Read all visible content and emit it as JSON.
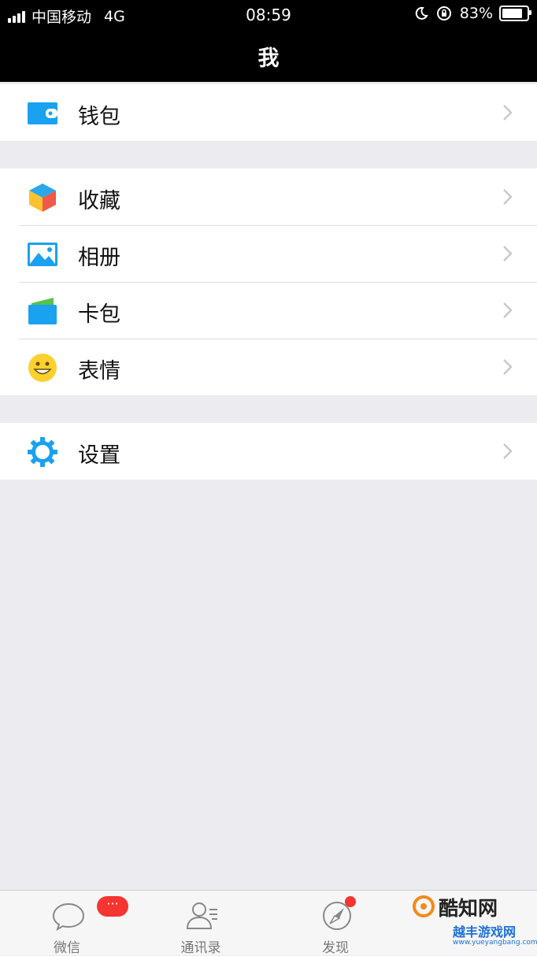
{
  "status_bar": {
    "carrier": "中国移动",
    "network": "4G",
    "time": "08:59",
    "battery": "83%",
    "battery_level": 0.83
  },
  "nav": {
    "title": "我"
  },
  "groups": [
    {
      "items": [
        {
          "label": "钱包",
          "icon": "wallet-icon"
        }
      ]
    },
    {
      "items": [
        {
          "label": "收藏",
          "icon": "favorites-cube-icon"
        },
        {
          "label": "相册",
          "icon": "album-picture-icon"
        },
        {
          "label": "卡包",
          "icon": "card-pack-icon"
        },
        {
          "label": "表情",
          "icon": "smiley-face-icon"
        }
      ]
    },
    {
      "items": [
        {
          "label": "设置",
          "icon": "gear-icon"
        }
      ]
    }
  ],
  "tabbar": {
    "tabs": [
      {
        "label": "微信",
        "icon": "chat-bubble-icon",
        "badge": "···"
      },
      {
        "label": "通讯录",
        "icon": "contacts-icon"
      },
      {
        "label": "发现",
        "icon": "compass-icon"
      }
    ]
  },
  "watermark": {
    "line1": "酷知网",
    "line2": "越丰游戏网",
    "line3": "www.yueyangbang.com"
  },
  "colors": {
    "accent_blue": "#1aa1f0",
    "badge_red": "#f43530",
    "background": "#ebebf0"
  }
}
